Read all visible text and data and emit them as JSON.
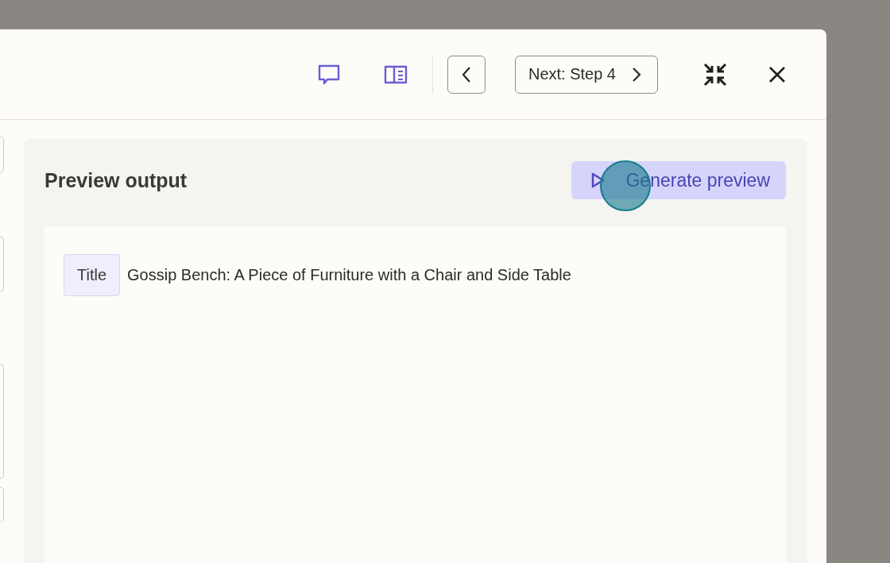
{
  "toolbar": {
    "next_button": {
      "label": "Next: Step 4"
    }
  },
  "preview": {
    "title": "Preview output",
    "generate_button": {
      "label": "Generate preview"
    },
    "fields": [
      {
        "label": "Title",
        "value": "Gossip Bench: A Piece of Furniture with a Chair and Side Table"
      }
    ]
  },
  "click_indicator": {
    "on": true
  }
}
